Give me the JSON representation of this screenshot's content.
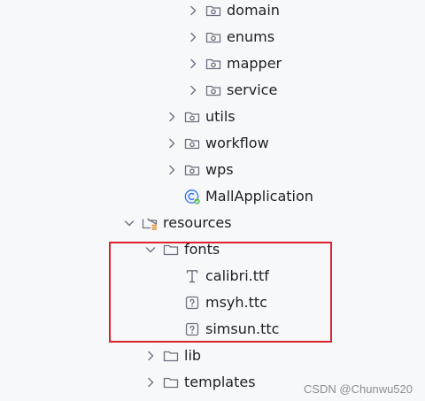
{
  "tree": {
    "nodes": [
      {
        "label": "domain",
        "icon": "package-folder-icon",
        "depth": 4,
        "expanded": false
      },
      {
        "label": "enums",
        "icon": "package-folder-icon",
        "depth": 4,
        "expanded": false
      },
      {
        "label": "mapper",
        "icon": "package-folder-icon",
        "depth": 4,
        "expanded": false
      },
      {
        "label": "service",
        "icon": "package-folder-icon",
        "depth": 4,
        "expanded": false
      },
      {
        "label": "utils",
        "icon": "package-folder-icon",
        "depth": 3,
        "expanded": false
      },
      {
        "label": "workflow",
        "icon": "package-folder-icon",
        "depth": 3,
        "expanded": false
      },
      {
        "label": "wps",
        "icon": "package-folder-icon",
        "depth": 3,
        "expanded": false
      },
      {
        "label": "MallApplication",
        "icon": "spring-boot-class-icon",
        "depth": 3,
        "expanded": null
      },
      {
        "label": "resources",
        "icon": "resources-folder-icon",
        "depth": 1,
        "expanded": true
      },
      {
        "label": "fonts",
        "icon": "folder-icon",
        "depth": 2,
        "expanded": true
      },
      {
        "label": "calibri.ttf",
        "icon": "font-file-icon",
        "depth": 3,
        "expanded": null
      },
      {
        "label": "msyh.ttc",
        "icon": "unknown-file-icon",
        "depth": 3,
        "expanded": null
      },
      {
        "label": "simsun.ttc",
        "icon": "unknown-file-icon",
        "depth": 3,
        "expanded": null
      },
      {
        "label": "lib",
        "icon": "folder-icon",
        "depth": 2,
        "expanded": false
      },
      {
        "label": "templates",
        "icon": "folder-icon",
        "depth": 2,
        "expanded": false
      }
    ]
  },
  "annotation": {
    "highlight_color": "#d9232d"
  },
  "watermark": {
    "text": "CSDN @Chunwu520"
  }
}
